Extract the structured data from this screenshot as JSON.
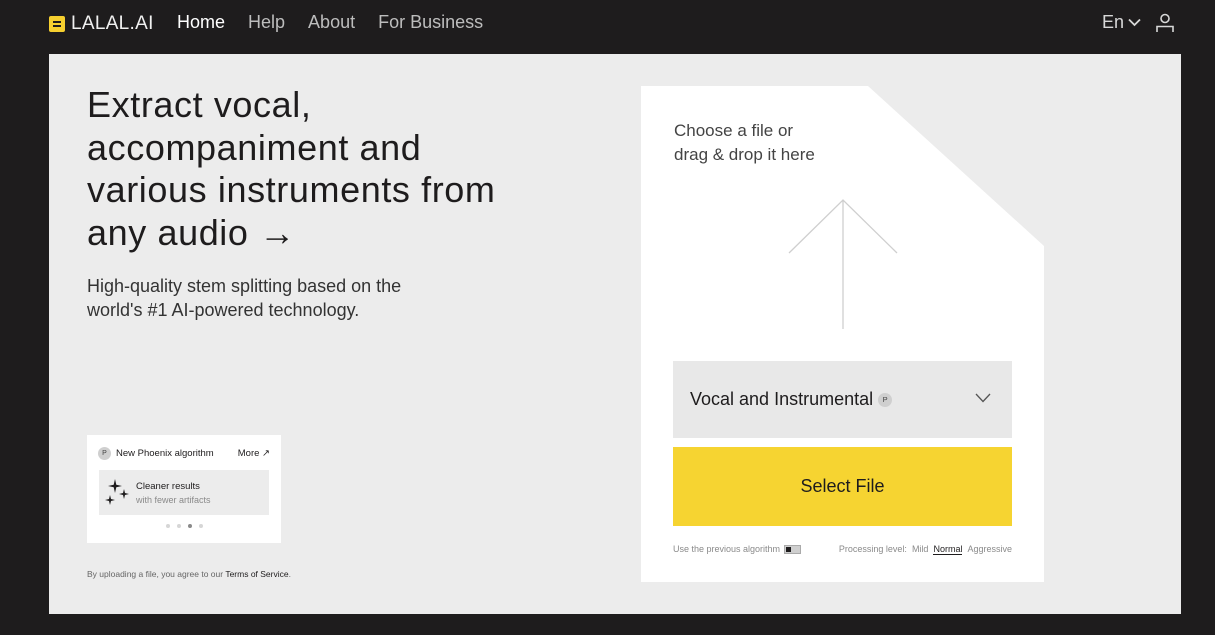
{
  "header": {
    "logo_text": "LALAL.AI",
    "nav": [
      {
        "label": "Home",
        "active": true
      },
      {
        "label": "Help",
        "active": false
      },
      {
        "label": "About",
        "active": false
      },
      {
        "label": "For Business",
        "active": false
      }
    ],
    "language": "En",
    "icons": {
      "user": "user-icon",
      "language_dropdown": "chevron-down-icon"
    }
  },
  "hero": {
    "title": "Extract vocal, accompaniment and various instruments from any audio →",
    "subtitle": "High-quality stem splitting based on the world's #1 AI-powered technology."
  },
  "promo": {
    "badge_icon": "P",
    "badge_label": "New Phoenix algorithm",
    "more_link": "More ↗",
    "card_title": "Cleaner results",
    "card_subtitle": "with fewer artifacts",
    "active_dot": 3,
    "dot_count": 4
  },
  "terms": {
    "prefix": "By uploading a file, you agree to our",
    "link": "Terms of Service",
    "suffix": "."
  },
  "upload": {
    "drop_line1": "Choose a file or",
    "drop_line2": "drag & drop it here",
    "algorithm": "Vocal and Instrumental",
    "algorithm_badge": "P",
    "select_button": "Select File",
    "previous_algorithm_label": "Use the previous algorithm",
    "processing_label": "Processing level:",
    "levels": [
      "Mild",
      "Normal",
      "Aggressive"
    ],
    "active_level": "Normal"
  },
  "colors": {
    "background": "#1e1c1d",
    "panel": "#ececec",
    "accent_yellow": "#f6d431"
  }
}
